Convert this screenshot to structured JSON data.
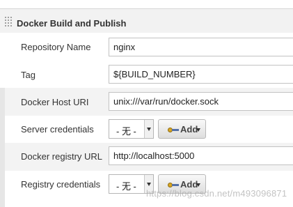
{
  "section": {
    "title": "Docker Build and Publish"
  },
  "fields": {
    "repository_name": {
      "label": "Repository Name",
      "value": "nginx"
    },
    "tag": {
      "label": "Tag",
      "value": "${BUILD_NUMBER}"
    },
    "docker_host_uri": {
      "label": "Docker Host URI",
      "value": "unix:///var/run/docker.sock"
    },
    "server_credentials": {
      "label": "Server credentials",
      "selected": "- 无 -",
      "add_label": "Add"
    },
    "docker_registry_url": {
      "label": "Docker registry URL",
      "value": "http://localhost:5000"
    },
    "registry_credentials": {
      "label": "Registry credentials",
      "selected": "- 无 -",
      "add_label": "Add"
    }
  },
  "watermark": "https://blog.csdn.net/m493096871"
}
